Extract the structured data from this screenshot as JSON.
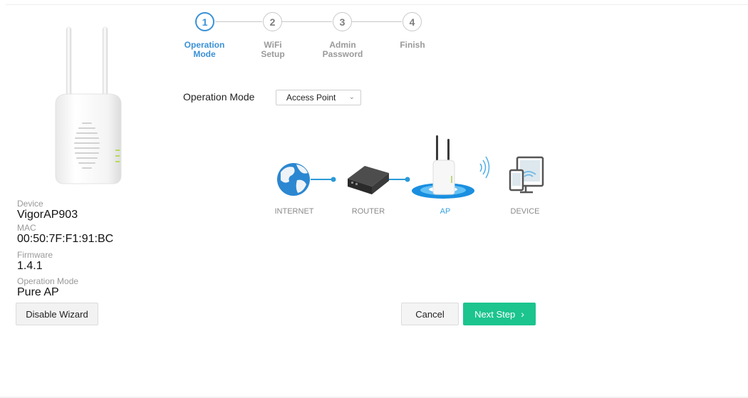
{
  "device_info": {
    "device_label": "Device",
    "device_value": "VigorAP903",
    "mac_label": "MAC",
    "mac_value": "00:50:7F:F1:91:BC",
    "firmware_label": "Firmware",
    "firmware_value": "1.4.1",
    "opmode_label": "Operation Mode",
    "opmode_value": "Pure AP"
  },
  "buttons": {
    "disable_wizard": "Disable Wizard",
    "cancel": "Cancel",
    "next_step": "Next Step"
  },
  "steps": [
    {
      "number": "1",
      "label": "Operation\nMode",
      "active": true
    },
    {
      "number": "2",
      "label": "WiFi\nSetup",
      "active": false
    },
    {
      "number": "3",
      "label": "Admin\nPassword",
      "active": false
    },
    {
      "number": "4",
      "label": "Finish",
      "active": false
    }
  ],
  "operation_mode": {
    "label": "Operation Mode",
    "selected": "Access Point"
  },
  "diagram": {
    "internet": "INTERNET",
    "router": "ROUTER",
    "ap": "AP",
    "device": "DEVICE"
  },
  "colors": {
    "accent_blue": "#3a91d6",
    "next_green": "#1cc48e",
    "ap_blue": "#39a3e0"
  },
  "icons": {
    "next": "chevron-right-icon",
    "select": "chevron-down-icon"
  }
}
